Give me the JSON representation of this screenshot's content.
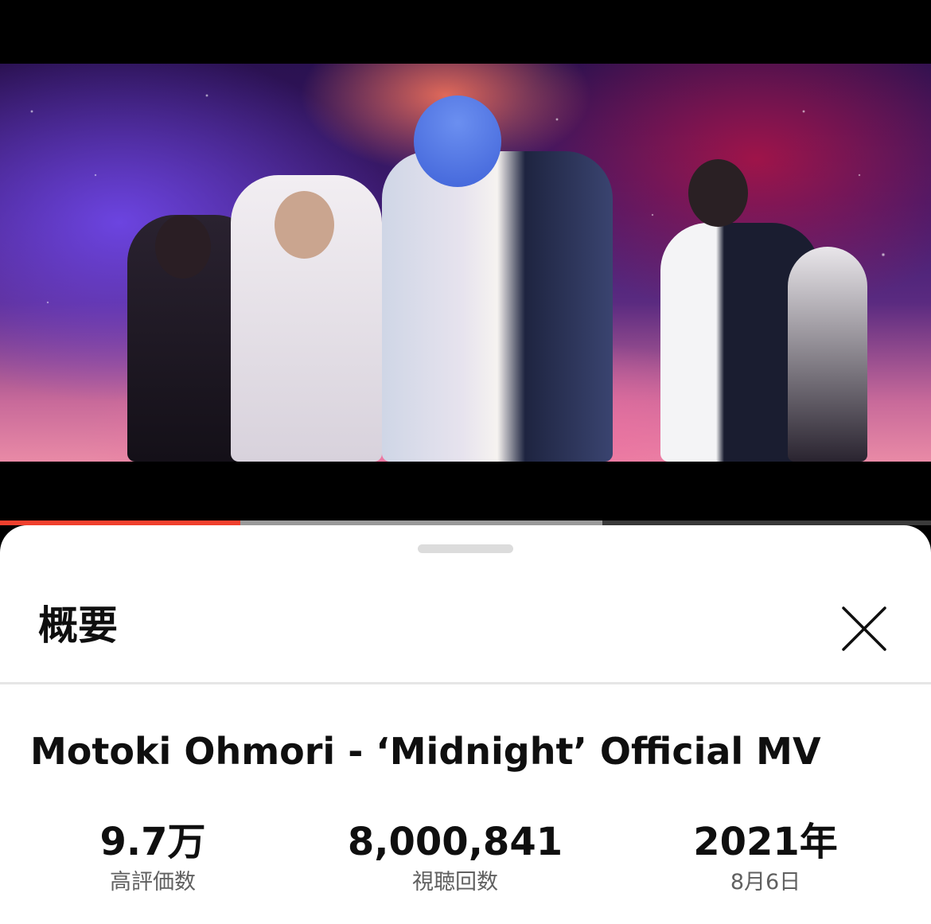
{
  "video": {
    "progress_played_fraction": 0.258,
    "progress_buffered_fraction": 0.647,
    "colors": {
      "played": "#f0402e",
      "buffered": "#9a9a9a",
      "track": "#3a3a3a"
    }
  },
  "sheet": {
    "title": "概要",
    "close_icon": "close-icon"
  },
  "details": {
    "video_title": "Motoki Ohmori - ‘Midnight’ Official MV",
    "stats": [
      {
        "value": "9.7万",
        "label": "高評価数"
      },
      {
        "value": "8,000,841",
        "label": "視聴回数"
      },
      {
        "value": "2021年",
        "label": "8月6日"
      }
    ]
  }
}
